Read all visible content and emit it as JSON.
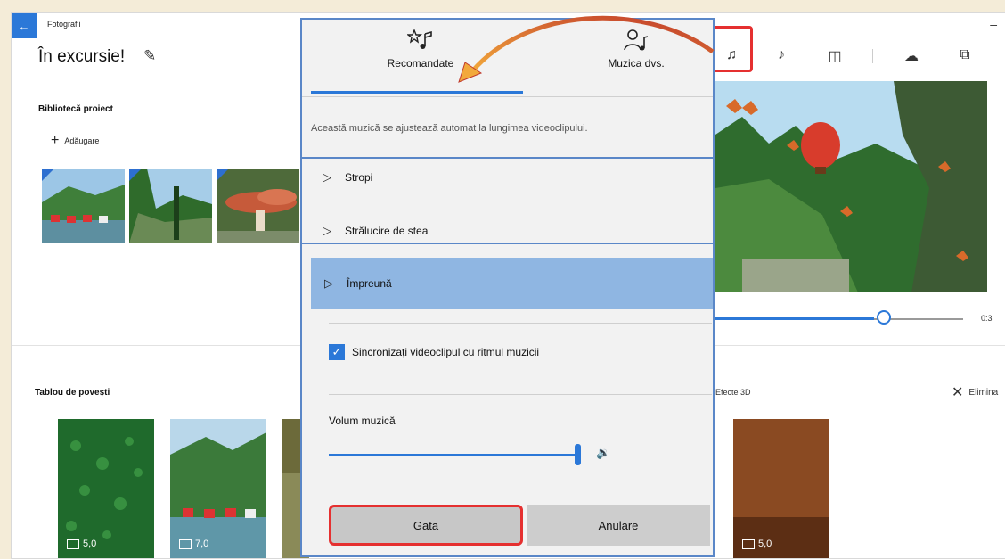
{
  "app": {
    "title": "Fotografii",
    "project_name": "În excursie!",
    "library_title": "Bibliotecă proiect",
    "add_label": "Adăugare",
    "storyboard_title": "Tablou de povești",
    "effects_label": "Efecte 3D",
    "remove_label": "Elimina",
    "time_end": "0:3"
  },
  "storyboard": {
    "clips": [
      {
        "duration": "5,0"
      },
      {
        "duration": "7,0"
      },
      {
        "duration": "5,0"
      }
    ]
  },
  "toolbar": {
    "icons": [
      "music-icon",
      "narration-icon",
      "aspect-ratio-icon",
      "cloud-upload-icon",
      "copy-icon"
    ]
  },
  "flyout": {
    "tab_recommended": "Recomandate",
    "tab_your_music": "Muzica dvs.",
    "description": "Această muzică se ajustează automat la lungimea videoclipului.",
    "tracks": [
      {
        "name": "Stropi",
        "selected": false
      },
      {
        "name": "Strălucire de stea",
        "selected": false
      },
      {
        "name": "Împreună",
        "selected": true
      }
    ],
    "sync_label": "Sincronizați videoclipul cu ritmul muzicii",
    "sync_checked": true,
    "volume_label": "Volum muzică",
    "volume_level": 1.0,
    "done_button": "Gata",
    "cancel_button": "Anulare"
  },
  "colors": {
    "accent": "#2b78d8",
    "highlight": "#e53030",
    "selected_track": "#8fb6e2",
    "arrow": "#e8842a"
  }
}
